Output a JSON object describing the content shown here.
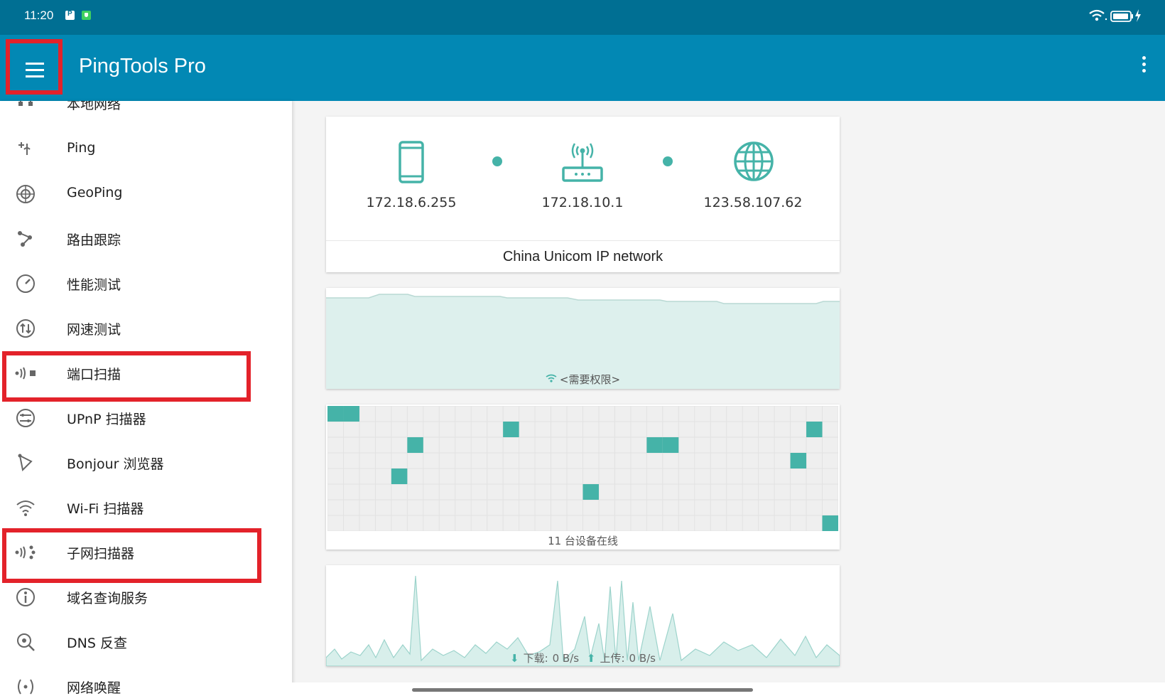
{
  "status_bar": {
    "time": "11:20"
  },
  "app_bar": {
    "title": "PingTools Pro"
  },
  "drawer": {
    "items": [
      {
        "label": "本地网络",
        "icon": "local-network-icon"
      },
      {
        "label": "Ping",
        "icon": "ping-icon"
      },
      {
        "label": "GeoPing",
        "icon": "globe-icon"
      },
      {
        "label": "路由跟踪",
        "icon": "traceroute-icon"
      },
      {
        "label": "性能测试",
        "icon": "speedometer-icon"
      },
      {
        "label": "网速测试",
        "icon": "up-down-arrows-icon"
      },
      {
        "label": "端口扫描",
        "icon": "port-scan-icon"
      },
      {
        "label": "UPnP 扫描器",
        "icon": "upnp-icon"
      },
      {
        "label": "Bonjour 浏览器",
        "icon": "bonjour-icon"
      },
      {
        "label": "Wi-Fi 扫描器",
        "icon": "wifi-icon"
      },
      {
        "label": "子网扫描器",
        "icon": "subnet-scan-icon"
      },
      {
        "label": "域名查询服务",
        "icon": "whois-icon"
      },
      {
        "label": "DNS 反查",
        "icon": "dns-lookup-icon"
      },
      {
        "label": "网络唤醒",
        "icon": "wake-on-lan-icon"
      }
    ]
  },
  "network_card": {
    "device_ip": "172.18.6.255",
    "router_ip": "172.18.10.1",
    "external_ip": "123.58.107.62",
    "network_name": "China Unicom IP network"
  },
  "wifi_card": {
    "status": "<需要权限>"
  },
  "devices_card": {
    "summary": "11 台设备在线",
    "grid_cols": 32,
    "grid_rows": 8
  },
  "traffic_card": {
    "download_label": "下载:",
    "download_value": "0 B/s",
    "upload_label": "上传:",
    "upload_value": "0 B/s"
  },
  "colors": {
    "status_bar": "#006f93",
    "app_bar": "#0288b4",
    "accent": "#45b3a8",
    "highlight": "#e3222a"
  }
}
